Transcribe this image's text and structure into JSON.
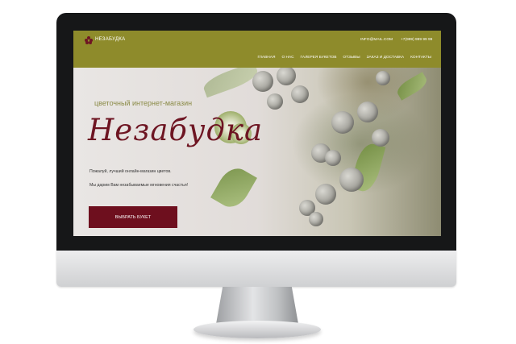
{
  "site": {
    "logo_text": "НЕЗАБУДКА",
    "email": "INFO@MAIL.COM",
    "phone": "+7(999) 999 99 99",
    "nav": [
      {
        "label": "ГЛАВНАЯ"
      },
      {
        "label": "О НАС"
      },
      {
        "label": "ГАЛЕРЕЯ БУКЕТОВ"
      },
      {
        "label": "ОТЗЫВЫ"
      },
      {
        "label": "ЗАКАЗ И ДОСТАВКА"
      },
      {
        "label": "КОНТАКТЫ"
      }
    ]
  },
  "hero": {
    "subtitle": "цветочный интернет-магазин",
    "title": "Незабудка",
    "line1": "Пожалуй, лучший онлайн-магазин цветов.",
    "line2": "Мы дарим Вам незабываемые мгновения счастья!",
    "cta_label": "ВЫБРАТЬ БУКЕТ"
  },
  "colors": {
    "header": "#8e8b2b",
    "accent": "#6e0f1e",
    "bezel": "#161718"
  },
  "icons": {
    "logo": "flower-logo-icon"
  }
}
